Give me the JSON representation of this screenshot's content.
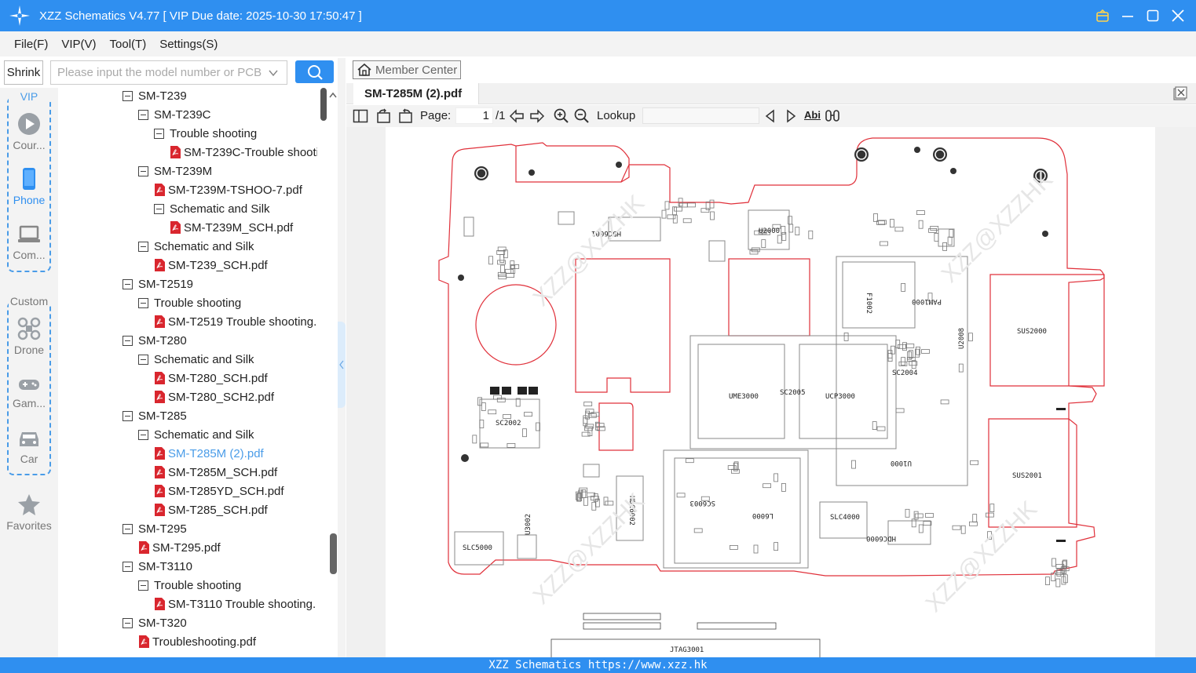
{
  "window": {
    "title": "XZZ Schematics V4.77 [ VIP Due date: 2025-10-30 17:50:47 ]"
  },
  "menu": [
    "File(F)",
    "VIP(V)",
    "Tool(T)",
    "Settings(S)"
  ],
  "search": {
    "shrink_label": "Shrink",
    "placeholder": "Please input the model number or PCB"
  },
  "rail": {
    "vip_title": "VIP",
    "custom_title": "Custom",
    "items": [
      "Cour...",
      "Phone",
      "Com...",
      "Drone",
      "Gam...",
      "Car",
      "Favorites"
    ],
    "selected": "Phone"
  },
  "tree": [
    {
      "level": 0,
      "type": "folder",
      "label": "SM-T239"
    },
    {
      "level": 1,
      "type": "folder",
      "label": "SM-T239C"
    },
    {
      "level": 2,
      "type": "folder",
      "label": "Trouble shooting"
    },
    {
      "level": 3,
      "type": "pdf",
      "label": "SM-T239C-Trouble shooti"
    },
    {
      "level": 1,
      "type": "folder",
      "label": "SM-T239M"
    },
    {
      "level": 2,
      "type": "pdf",
      "label": "SM-T239M-TSHOO-7.pdf"
    },
    {
      "level": 2,
      "type": "folder",
      "label": "Schematic and Silk"
    },
    {
      "level": 3,
      "type": "pdf",
      "label": "SM-T239M_SCH.pdf"
    },
    {
      "level": 1,
      "type": "folder",
      "label": "Schematic and Silk"
    },
    {
      "level": 2,
      "type": "pdf",
      "label": "SM-T239_SCH.pdf"
    },
    {
      "level": 0,
      "type": "folder",
      "label": "SM-T2519"
    },
    {
      "level": 1,
      "type": "folder",
      "label": "Trouble shooting"
    },
    {
      "level": 2,
      "type": "pdf",
      "label": "SM-T2519 Trouble shooting."
    },
    {
      "level": 0,
      "type": "folder",
      "label": "SM-T280"
    },
    {
      "level": 1,
      "type": "folder",
      "label": "Schematic and Silk"
    },
    {
      "level": 2,
      "type": "pdf",
      "label": "SM-T280_SCH.pdf"
    },
    {
      "level": 2,
      "type": "pdf",
      "label": "SM-T280_SCH2.pdf"
    },
    {
      "level": 0,
      "type": "folder",
      "label": "SM-T285"
    },
    {
      "level": 1,
      "type": "folder",
      "label": "Schematic and Silk"
    },
    {
      "level": 2,
      "type": "pdf",
      "label": "SM-T285M (2).pdf",
      "selected": true
    },
    {
      "level": 2,
      "type": "pdf",
      "label": "SM-T285M_SCH.pdf"
    },
    {
      "level": 2,
      "type": "pdf",
      "label": "SM-T285YD_SCH.pdf"
    },
    {
      "level": 2,
      "type": "pdf",
      "label": "SM-T285_SCH.pdf"
    },
    {
      "level": 0,
      "type": "folder",
      "label": "SM-T295"
    },
    {
      "level": 1,
      "type": "pdf",
      "label": "SM-T295.pdf"
    },
    {
      "level": 0,
      "type": "folder",
      "label": "SM-T3110"
    },
    {
      "level": 1,
      "type": "folder",
      "label": "Trouble shooting"
    },
    {
      "level": 2,
      "type": "pdf",
      "label": "SM-T3110 Trouble shooting."
    },
    {
      "level": 0,
      "type": "folder",
      "label": "SM-T320"
    },
    {
      "level": 1,
      "type": "pdf",
      "label": "Troubleshooting.pdf"
    }
  ],
  "viewer": {
    "member_center": "Member Center",
    "tab_title": "SM-T285M (2).pdf",
    "page_label": "Page:",
    "page_current": "1",
    "page_total": "/1",
    "lookup_label": "Lookup",
    "abi_label": "Abi"
  },
  "schematic_labels": [
    "HDC6001",
    "U2000",
    "UME3000",
    "SC2005",
    "UCP3000",
    "SC2004",
    "SC2002",
    "SUS2000",
    "SUS2001",
    "U2008",
    "F1002",
    "PAM1000",
    "U1000",
    "HDC6002",
    "SLC5000",
    "U3002",
    "SLC4000",
    "HDC6000",
    "L6000",
    "SC6003",
    "JTAG3001"
  ],
  "watermark": "XZZ@XZZHK",
  "status": "XZZ Schematics https://www.xzz.hk",
  "colors": {
    "accent": "#2f8ff0",
    "board_outline": "#e0303a",
    "selected_item": "#4a9ce8"
  }
}
